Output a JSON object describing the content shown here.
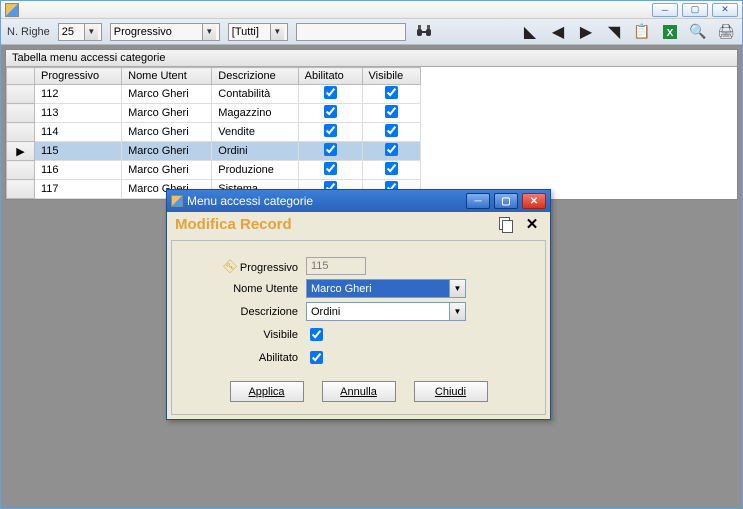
{
  "toolbar": {
    "righe_label": "N. Righe",
    "righe_value": "25",
    "col_filter": "Progressivo",
    "match_filter": "[Tutti]",
    "search_value": ""
  },
  "grid": {
    "title": "Tabella menu accessi categorie",
    "columns": [
      "Progressivo",
      "Nome Utent",
      "Descrizione",
      "Abilitato",
      "Visibile"
    ],
    "rows": [
      {
        "prog": "112",
        "user": "Marco Gheri",
        "desc": "Contabilità",
        "abil": true,
        "vis": true,
        "selected": false
      },
      {
        "prog": "113",
        "user": "Marco Gheri",
        "desc": "Magazzino",
        "abil": true,
        "vis": true,
        "selected": false
      },
      {
        "prog": "114",
        "user": "Marco Gheri",
        "desc": "Vendite",
        "abil": true,
        "vis": true,
        "selected": false
      },
      {
        "prog": "115",
        "user": "Marco Gheri",
        "desc": "Ordini",
        "abil": true,
        "vis": true,
        "selected": true
      },
      {
        "prog": "116",
        "user": "Marco Gheri",
        "desc": "Produzione",
        "abil": true,
        "vis": true,
        "selected": false
      },
      {
        "prog": "117",
        "user": "Marco Gheri",
        "desc": "Sistema",
        "abil": true,
        "vis": true,
        "selected": false
      }
    ]
  },
  "dialog": {
    "title": "Menu accessi categorie",
    "heading": "Modifica Record",
    "fields": {
      "progressivo_label": "Progressivo",
      "progressivo_value": "115",
      "nome_label": "Nome Utente",
      "nome_value": "Marco Gheri",
      "descr_label": "Descrizione",
      "descr_value": "Ordini",
      "visibile_label": "Visibile",
      "visibile_value": true,
      "abilitato_label": "Abilitato",
      "abilitato_value": true
    },
    "buttons": {
      "applica": "Applica",
      "annulla": "Annulla",
      "chiudi": "Chiudi"
    }
  }
}
